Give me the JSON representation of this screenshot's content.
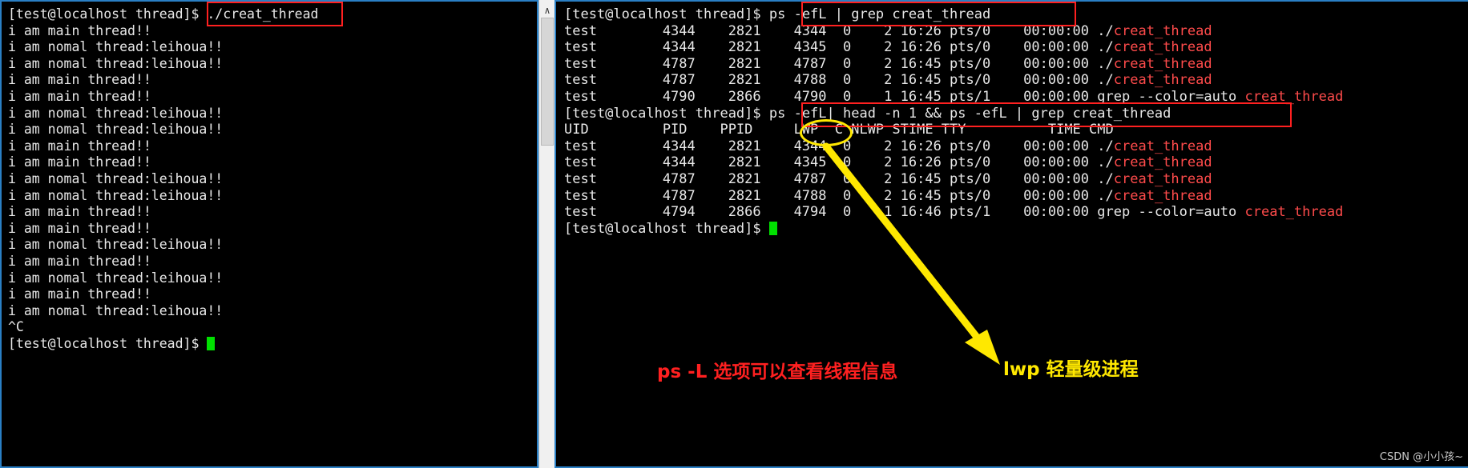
{
  "left_terminal": {
    "name": "left-terminal",
    "prompt": "[test@localhost thread]$ ",
    "command": "./creat_thread",
    "output_lines": [
      "i am main thread!!",
      "i am nomal thread:leihoua!!",
      "i am nomal thread:leihoua!!",
      "i am main thread!!",
      "i am main thread!!",
      "i am nomal thread:leihoua!!",
      "i am nomal thread:leihoua!!",
      "i am main thread!!",
      "i am main thread!!",
      "i am nomal thread:leihoua!!",
      "i am nomal thread:leihoua!!",
      "i am main thread!!",
      "i am main thread!!",
      "i am nomal thread:leihoua!!",
      "i am main thread!!",
      "i am nomal thread:leihoua!!",
      "i am main thread!!",
      "i am nomal thread:leihoua!!",
      "^C"
    ],
    "final_prompt": "[test@localhost thread]$ "
  },
  "right_terminal": {
    "name": "right-terminal",
    "prompt": "[test@localhost thread]$ ",
    "command_1": "ps -efL | grep creat_thread",
    "command_2": "ps -efL| head -n 1 && ps -efL | grep creat_thread",
    "header_row": "UID         PID    PPID     LWP  C NLWP STIME TTY          TIME CMD",
    "block_1": [
      {
        "cols": "test        4344    2821    4344  0    2 16:26 pts/0    00:00:00 ",
        "cmd_plain": "./",
        "cmd_red": "creat_thread"
      },
      {
        "cols": "test        4344    2821    4345  0    2 16:26 pts/0    00:00:00 ",
        "cmd_plain": "./",
        "cmd_red": "creat_thread"
      },
      {
        "cols": "test        4787    2821    4787  0    2 16:45 pts/0    00:00:00 ",
        "cmd_plain": "./",
        "cmd_red": "creat_thread"
      },
      {
        "cols": "test        4787    2821    4788  0    2 16:45 pts/0    00:00:00 ",
        "cmd_plain": "./",
        "cmd_red": "creat_thread"
      },
      {
        "cols": "test        4790    2866    4790  0    1 16:45 pts/1    00:00:00 ",
        "cmd_plain": "grep --color=auto ",
        "cmd_red": "creat_thread"
      }
    ],
    "block_2": [
      {
        "cols": "test        4344    2821    4344  0    2 16:26 pts/0    00:00:00 ",
        "cmd_plain": "./",
        "cmd_red": "creat_thread"
      },
      {
        "cols": "test        4344    2821    4345  0    2 16:26 pts/0    00:00:00 ",
        "cmd_plain": "./",
        "cmd_red": "creat_thread"
      },
      {
        "cols": "test        4787    2821    4787  0    2 16:45 pts/0    00:00:00 ",
        "cmd_plain": "./",
        "cmd_red": "creat_thread"
      },
      {
        "cols": "test        4787    2821    4788  0    2 16:45 pts/0    00:00:00 ",
        "cmd_plain": "./",
        "cmd_red": "creat_thread"
      },
      {
        "cols": "test        4794    2866    4794  0    1 16:46 pts/1    00:00:00 ",
        "cmd_plain": "grep --color=auto ",
        "cmd_red": "creat_thread"
      }
    ],
    "final_prompt": "[test@localhost thread]$ "
  },
  "annotations": {
    "note_red": "ps -L 选项可以查看线程信息",
    "note_yellow": "lwp 轻量级进程",
    "highlight_color": "#ff2020",
    "circle_color": "#ffe800"
  },
  "watermark": "CSDN @小小孩~",
  "scrollbar": {
    "up_arrow": "∧"
  }
}
